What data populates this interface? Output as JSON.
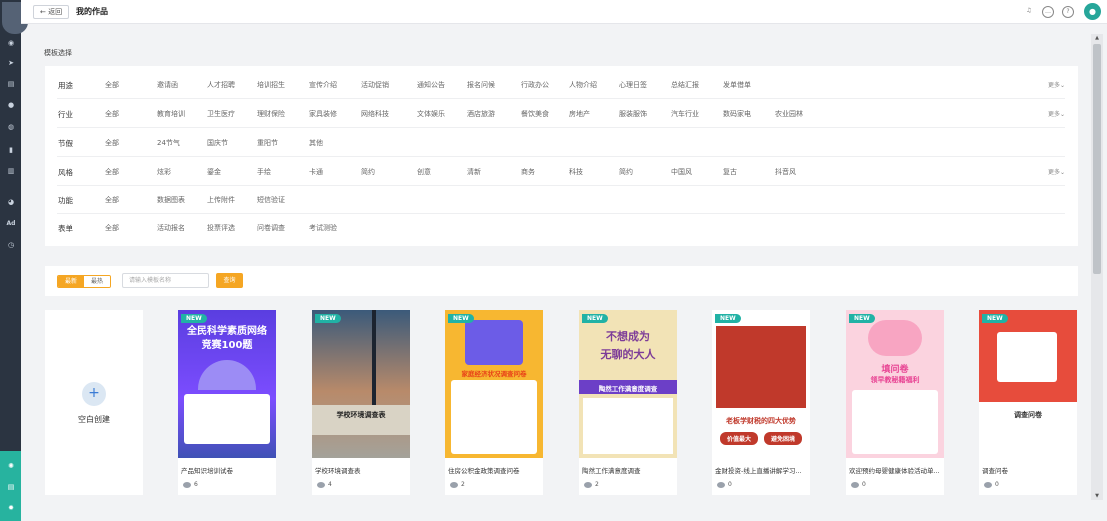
{
  "header": {
    "back_label": "← 返回",
    "title": "我的作品"
  },
  "template_select_label": "模板选择",
  "filters": [
    {
      "name": "用途",
      "options": [
        "全部",
        "邀请函",
        "人才招聘",
        "培训招生",
        "宣传介绍",
        "活动促销",
        "通知公告",
        "报名问候",
        "行政办公",
        "人物介绍",
        "心理日签",
        "总结汇报",
        "发单借单"
      ],
      "more": "更多⌄"
    },
    {
      "name": "行业",
      "options": [
        "全部",
        "教育培训",
        "卫生医疗",
        "理财保险",
        "家具装修",
        "网络科技",
        "文体娱乐",
        "酒店旅游",
        "餐饮美食",
        "房地产",
        "服装服饰",
        "汽车行业",
        "数码家电",
        "农业园林"
      ],
      "more": "更多⌄"
    },
    {
      "name": "节假",
      "options": [
        "全部",
        "24节气",
        "国庆节",
        "重阳节",
        "其他"
      ],
      "more": ""
    },
    {
      "name": "风格",
      "options": [
        "全部",
        "炫彩",
        "鎏金",
        "手绘",
        "卡通",
        "简约",
        "创意",
        "清新",
        "商务",
        "科技",
        "简约",
        "中国风",
        "复古",
        "抖音风"
      ],
      "more": "更多⌄"
    },
    {
      "name": "功能",
      "options": [
        "全部",
        "数据图表",
        "上传附件",
        "短信验证"
      ],
      "more": ""
    },
    {
      "name": "表单",
      "options": [
        "全部",
        "活动报名",
        "投票评选",
        "问卷调查",
        "考试测验"
      ],
      "more": ""
    }
  ],
  "toolbar": {
    "tab_latest": "最新",
    "tab_hot": "最热",
    "search_placeholder": "请输入模板名称",
    "query_label": "查询"
  },
  "blank_card": {
    "label": "空白创建"
  },
  "cards": [
    {
      "badge": "NEW",
      "title": "产品知识培训试卷",
      "views": "6",
      "thumb_lines": [
        "全民科学素质网络",
        "竞赛100题"
      ]
    },
    {
      "badge": "NEW",
      "title": "学校环境调查表",
      "views": "4",
      "thumb_lines": [
        "学校环境调查表"
      ]
    },
    {
      "badge": "NEW",
      "title": "住房公积金政策调查问卷",
      "views": "2",
      "thumb_lines": [
        "家庭经济状况调查问卷"
      ]
    },
    {
      "badge": "NEW",
      "title": "陶然工作满意度调查",
      "views": "2",
      "thumb_lines": [
        "不想成为",
        "无聊的大人",
        "陶然工作满意度调查"
      ]
    },
    {
      "badge": "NEW",
      "title": "金财投资-线上直播讲解学习...",
      "views": "0",
      "thumb_lines": [
        "老板学财税的四大优势",
        "价值最大",
        "避免困境"
      ]
    },
    {
      "badge": "NEW",
      "title": "欢迎预约母婴健康体验活动单...",
      "views": "0",
      "thumb_lines": [
        "填问卷",
        "领早教秘籍福利"
      ]
    },
    {
      "badge": "NEW",
      "title": "调查问卷",
      "views": "0",
      "thumb_lines": [
        "调查问卷"
      ]
    }
  ]
}
